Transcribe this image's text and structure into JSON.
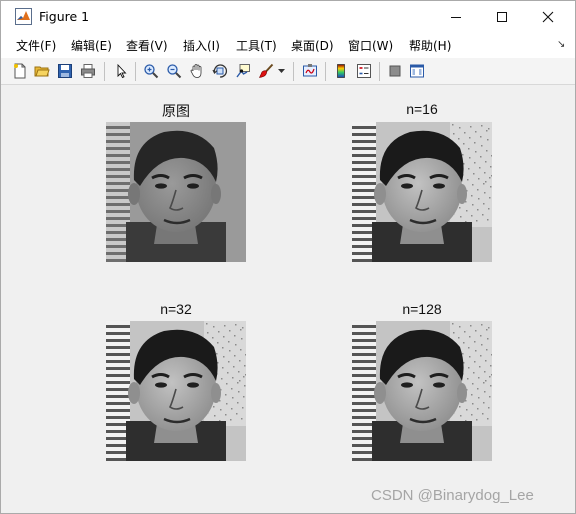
{
  "window": {
    "title": "Figure 1"
  },
  "menu": {
    "items": [
      "文件(F)",
      "编辑(E)",
      "查看(V)",
      "插入(I)",
      "工具(T)",
      "桌面(D)",
      "窗口(W)",
      "帮助(H)"
    ]
  },
  "toolbar": {
    "icons": [
      "new-figure-icon",
      "open-file-icon",
      "save-icon",
      "print-icon",
      "edit-plot-arrow-icon",
      "zoom-in-icon",
      "zoom-out-icon",
      "pan-hand-icon",
      "rotate-3d-icon",
      "data-cursor-icon",
      "brush-icon",
      "link-plot-icon",
      "colorbar-icon",
      "legend-icon",
      "hide-plot-tools-icon",
      "show-plot-tools-icon"
    ]
  },
  "subplots": [
    {
      "title": "原图",
      "shading": "original"
    },
    {
      "title": "n=16",
      "shading": "enhanced"
    },
    {
      "title": "n=32",
      "shading": "enhanced"
    },
    {
      "title": "n=128",
      "shading": "enhanced"
    }
  ],
  "watermark": "CSDN @Binarydog_Lee",
  "colors": {
    "titlebar": "#ffffff",
    "figure_background": "#f0f0f0",
    "close_hover": "#e81123"
  }
}
